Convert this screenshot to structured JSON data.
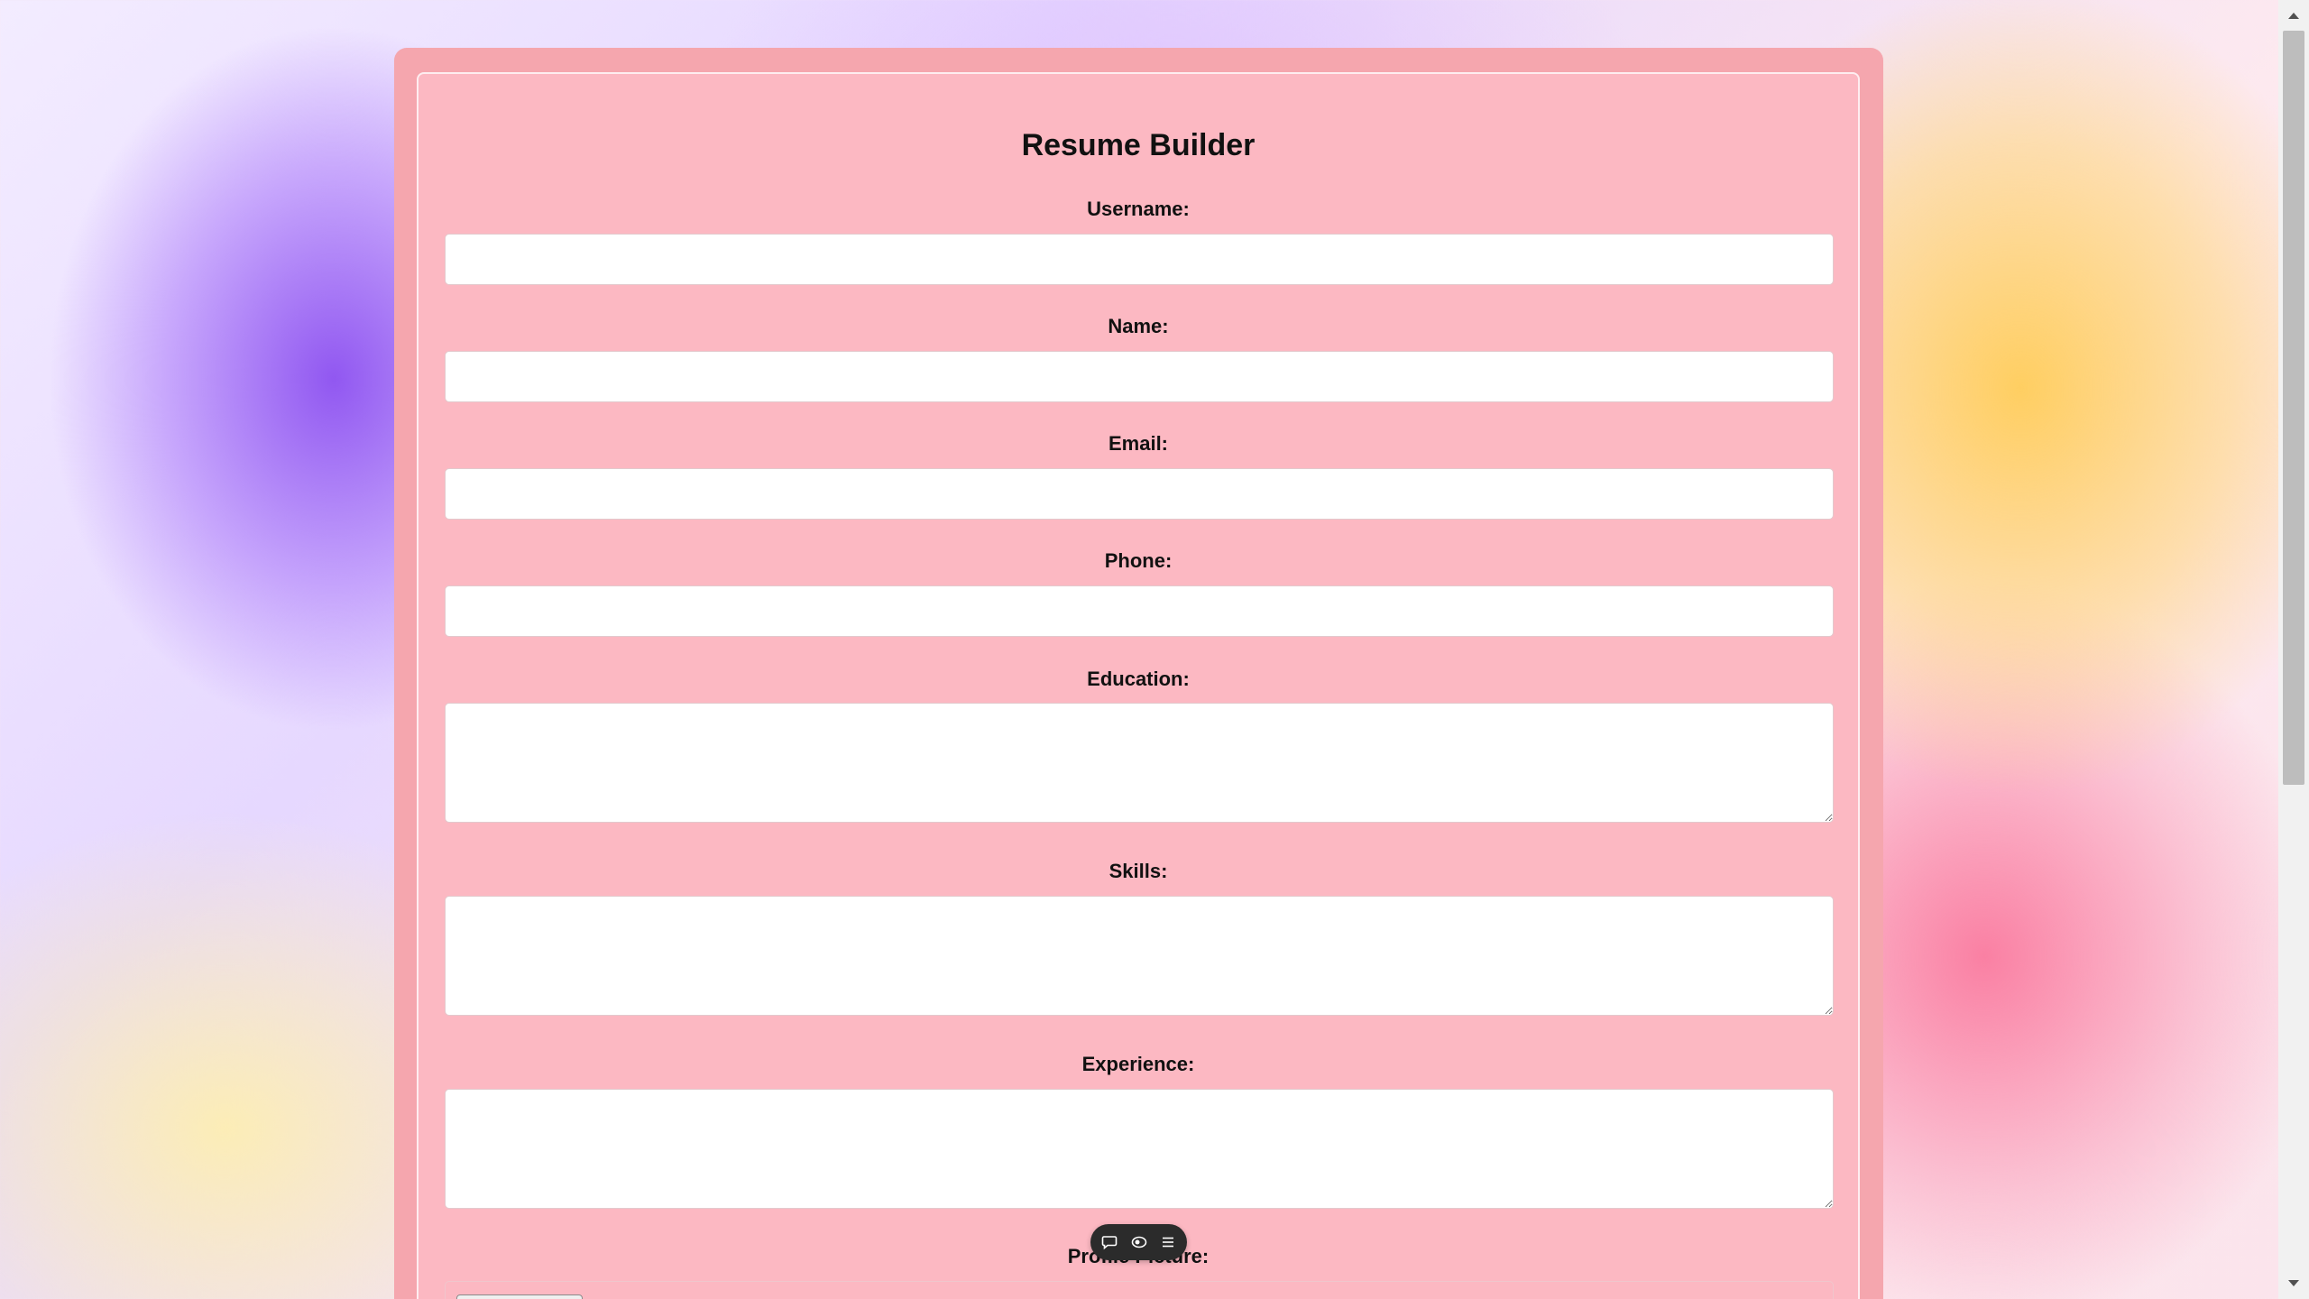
{
  "form": {
    "title": "Resume Builder",
    "fields": {
      "username": {
        "label": "Username:",
        "value": ""
      },
      "name": {
        "label": "Name:",
        "value": ""
      },
      "email": {
        "label": "Email:",
        "value": ""
      },
      "phone": {
        "label": "Phone:",
        "value": ""
      },
      "education": {
        "label": "Education:",
        "value": ""
      },
      "skills": {
        "label": "Skills:",
        "value": ""
      },
      "experience": {
        "label": "Experience:",
        "value": ""
      },
      "profile_picture": {
        "label": "Profile Picture:"
      }
    }
  },
  "toolbar": {
    "icons": [
      "comment-icon",
      "toggle-icon",
      "menu-icon"
    ]
  },
  "colors": {
    "card_outer": "#f5a6ae",
    "card_inner": "#fcb8c2",
    "toolbar_bg": "#2b2b2b"
  }
}
